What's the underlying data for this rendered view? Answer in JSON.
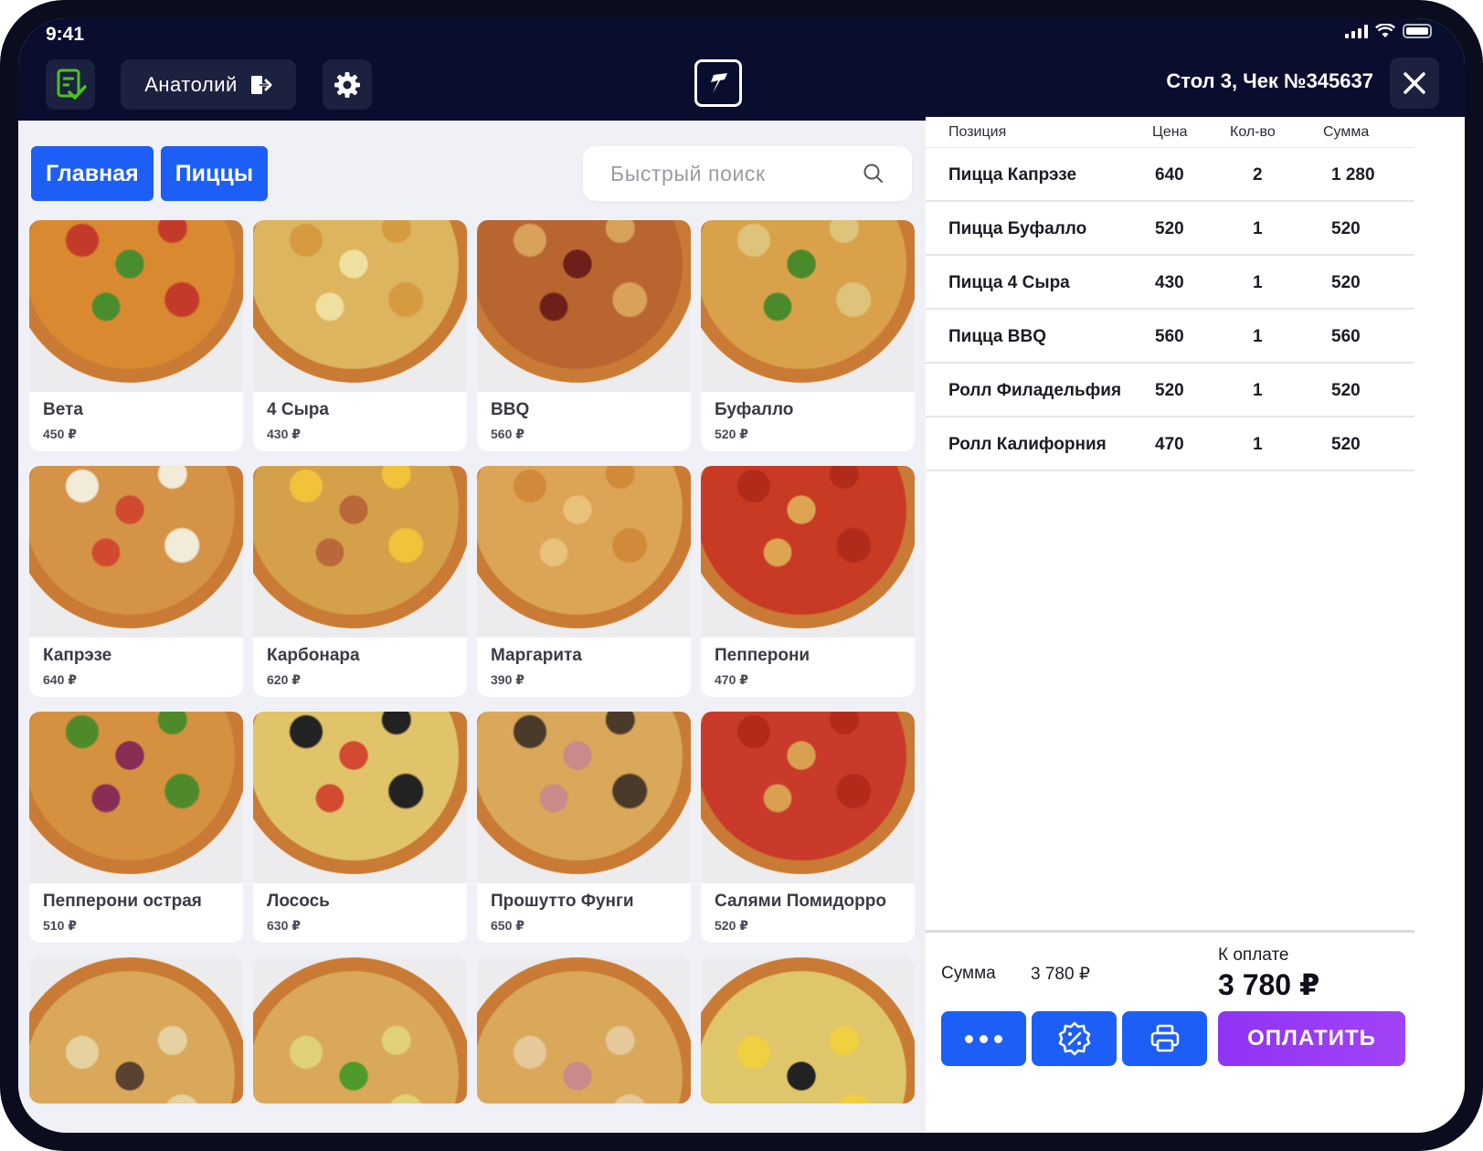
{
  "status_bar": {
    "time": "9:41"
  },
  "header": {
    "user_name": "Анатолий",
    "table_title": "Стол 3, Чек №345637",
    "icons": {
      "doc": "document-check-icon",
      "logout": "logout-icon",
      "settings": "gear-icon",
      "logo": "app-logo",
      "close": "close-icon"
    }
  },
  "nav": {
    "tabs": [
      {
        "label": "Главная"
      },
      {
        "label": "Пиццы"
      }
    ],
    "search_placeholder": "Быстрый поиск"
  },
  "menu": {
    "items": [
      {
        "name": "Вета",
        "price": "450 ₽",
        "colors": [
          "#d9892f",
          "#4a8d2f",
          "#c43a2a"
        ]
      },
      {
        "name": "4 Сыра",
        "price": "430 ₽",
        "colors": [
          "#dcb55e",
          "#efe0a0",
          "#d69a3f"
        ]
      },
      {
        "name": "BBQ",
        "price": "560 ₽",
        "colors": [
          "#b9652f",
          "#6e1f19",
          "#d8a25a"
        ]
      },
      {
        "name": "Буфалло",
        "price": "520 ₽",
        "colors": [
          "#d9a24a",
          "#4b8a2a",
          "#e0c37a"
        ]
      },
      {
        "name": "Капрэзе",
        "price": "640 ₽",
        "colors": [
          "#d49346",
          "#d14a30",
          "#f1ebd8"
        ]
      },
      {
        "name": "Карбонара",
        "price": "620 ₽",
        "colors": [
          "#d4a04a",
          "#b9683a",
          "#f2c23a"
        ]
      },
      {
        "name": "Маргарита",
        "price": "390 ₽",
        "colors": [
          "#dca456",
          "#e8c27a",
          "#d08a3a"
        ]
      },
      {
        "name": "Пепперони",
        "price": "470 ₽",
        "colors": [
          "#c93a24",
          "#dda552",
          "#b22a1a"
        ]
      },
      {
        "name": "Пепперони острая",
        "price": "510 ₽",
        "colors": [
          "#d5913f",
          "#8a2d55",
          "#4f8a2a"
        ]
      },
      {
        "name": "Лосось",
        "price": "630 ₽",
        "colors": [
          "#e1c36a",
          "#d24a30",
          "#222222"
        ]
      },
      {
        "name": "Прошутто Фунги",
        "price": "650 ₽",
        "colors": [
          "#d9a85a",
          "#c98a8a",
          "#4a3a2a"
        ]
      },
      {
        "name": "Салями Помидорро",
        "price": "520 ₽",
        "colors": [
          "#c93a2a",
          "#d8a050",
          "#b32a1a"
        ]
      }
    ],
    "partial_items": [
      {
        "colors": [
          "#d9a85a",
          "#5a4230",
          "#e6d2a0"
        ]
      },
      {
        "colors": [
          "#d9a85a",
          "#4f9a2a",
          "#e0d07a"
        ]
      },
      {
        "colors": [
          "#d9a85a",
          "#c98a8a",
          "#e6c89a"
        ]
      },
      {
        "colors": [
          "#e0c66a",
          "#222222",
          "#f0d040"
        ]
      }
    ]
  },
  "order": {
    "headers": {
      "position": "Позиция",
      "price": "Цена",
      "qty": "Кол-во",
      "sum": "Сумма"
    },
    "rows": [
      {
        "name": "Пицца Капрэзе",
        "price": "640",
        "qty": "2",
        "sum": "1 280"
      },
      {
        "name": "Пицца Буфалло",
        "price": "520",
        "qty": "1",
        "sum": "520"
      },
      {
        "name": "Пицца 4 Сыра",
        "price": "430",
        "qty": "1",
        "sum": "520"
      },
      {
        "name": "Пицца BBQ",
        "price": "560",
        "qty": "1",
        "sum": "560"
      },
      {
        "name": "Ролл Филадельфия",
        "price": "520",
        "qty": "1",
        "sum": "520"
      },
      {
        "name": "Ролл Калифорния",
        "price": "470",
        "qty": "1",
        "sum": "520"
      }
    ],
    "sum_label": "Сумма",
    "sum_value": "3 780 ₽",
    "to_pay_label": "К оплате",
    "to_pay_value": "3 780 ₽",
    "pay_button": "ОПЛАТИТЬ",
    "action_icons": [
      "more-icon",
      "discount-icon",
      "print-icon"
    ]
  },
  "theme": {
    "accent": "#1d5ef6",
    "pay": "#9a3df5",
    "header_bg": "#0a0e2e"
  }
}
